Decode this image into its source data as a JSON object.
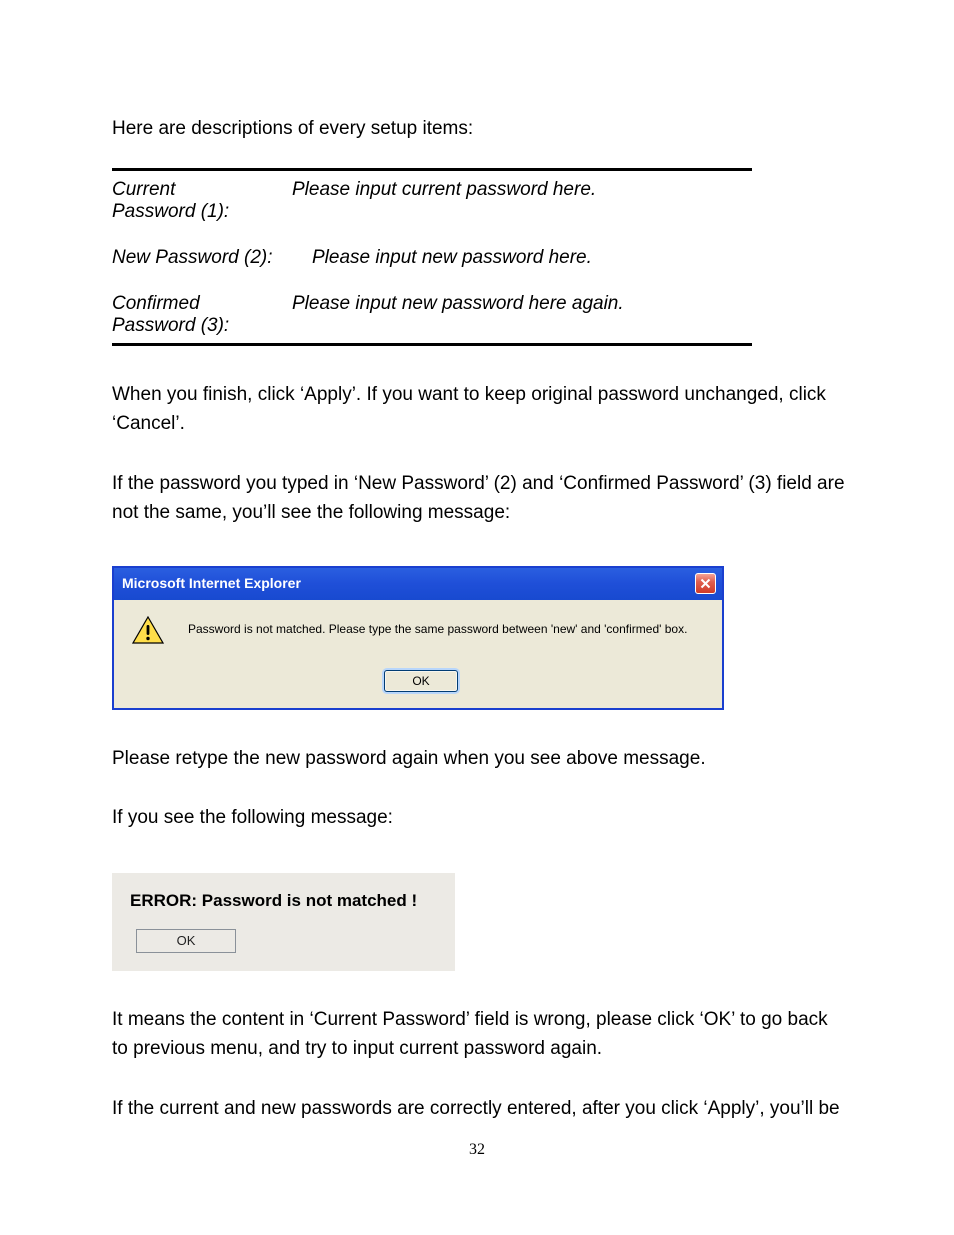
{
  "intro": "Here are descriptions of every setup items:",
  "defs": {
    "row1_term_line1": "Current",
    "row1_term_line2": "Password (1):",
    "row1_desc": "Please input current password here.",
    "row2_term": "New Password (2):",
    "row2_desc": "Please input new password here.",
    "row3_term_line1": "Confirmed",
    "row3_term_line2": "Password (3):",
    "row3_desc": "Please input new password here again."
  },
  "para_after_table": "When you finish, click ‘Apply’. If you want to keep original password unchanged, click ‘Cancel’.",
  "para_mismatch": "If the password you typed in ‘New Password’ (2) and ‘Confirmed Password’ (3) field are not the same, you’ll see the following message:",
  "dialog1": {
    "title": "Microsoft Internet Explorer",
    "message": "Password is not matched. Please type the same password between 'new' and 'confirmed' box.",
    "ok_label": "OK",
    "close_icon": "close-icon",
    "warn_icon": "warning-icon"
  },
  "para_retype": "Please retype the new password again when you see above message.",
  "para_following": "If you see the following message:",
  "dialog2": {
    "title": "ERROR: Password is not matched !",
    "ok_label": "OK"
  },
  "para_means": "It means the content in ‘Current Password’ field is wrong, please click ‘OK’ to go back to previous menu, and try to input current password again.",
  "para_final": "If the current and new passwords are correctly entered, after you click ‘Apply’, you’ll be",
  "page_number": "32"
}
